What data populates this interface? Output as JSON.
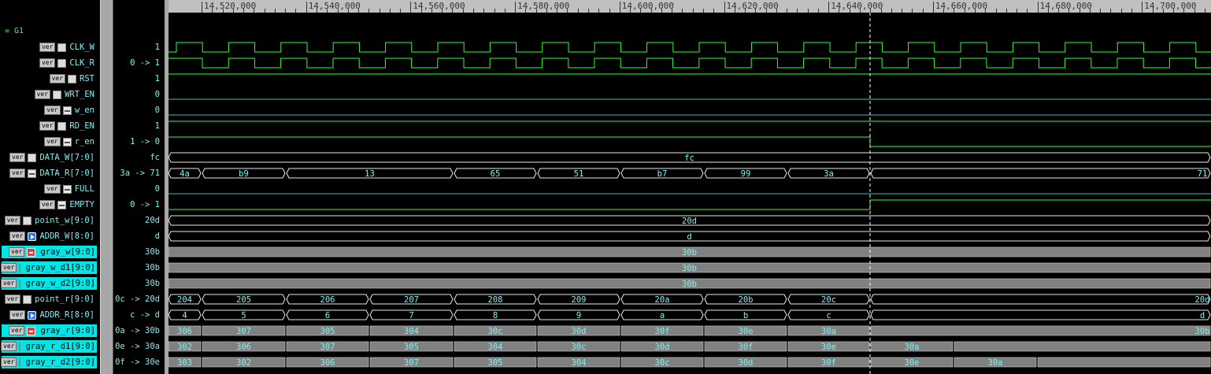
{
  "group_label": "= G1",
  "timeline": {
    "ticks": [
      "14,520,000",
      "14,540,000",
      "14,560,000",
      "14,580,000",
      "14,600,000",
      "14,620,000",
      "14,640,000",
      "14,660,000",
      "14,680,000",
      "14,700,000"
    ],
    "cursor_time": 14640000
  },
  "signals": [
    {
      "name": "CLK_W",
      "value": "1",
      "kind": "clock",
      "icon": "reg-icon"
    },
    {
      "name": "CLK_R",
      "value": "0 -> 1",
      "kind": "clock",
      "icon": "reg-icon"
    },
    {
      "name": "RST",
      "value": "1",
      "kind": "bit",
      "icon": "reg-icon"
    },
    {
      "name": "WRT_EN",
      "value": "0",
      "kind": "bit",
      "icon": "reg-icon"
    },
    {
      "name": "w_en",
      "value": "0",
      "kind": "bit",
      "icon": "wire-icon"
    },
    {
      "name": "RD_EN",
      "value": "1",
      "kind": "bit",
      "icon": "reg-icon"
    },
    {
      "name": "r_en",
      "value": "1 -> 0",
      "kind": "bit",
      "icon": "wire-icon"
    },
    {
      "name": "DATA_W[7:0]",
      "value": "fc",
      "kind": "bus",
      "icon": "reg-icon",
      "segments": [
        "fc"
      ]
    },
    {
      "name": "DATA_R[7:0]",
      "value": "3a -> 71",
      "kind": "bus",
      "icon": "wire-icon",
      "segments": [
        "4a",
        "b9",
        "13",
        "65",
        "51",
        "b7",
        "99",
        "3a",
        "71"
      ]
    },
    {
      "name": "FULL",
      "value": "0",
      "kind": "bit",
      "icon": "wire-icon"
    },
    {
      "name": "EMPTY",
      "value": "0 -> 1",
      "kind": "bit",
      "icon": "wire-icon"
    },
    {
      "name": "point_w[9:0]",
      "value": "20d",
      "kind": "bus",
      "icon": "reg-icon",
      "segments": [
        "20d"
      ]
    },
    {
      "name": "ADDR_W[8:0]",
      "value": "d",
      "kind": "bus",
      "icon": "arrow-icon",
      "segments": [
        "d"
      ]
    },
    {
      "name": "gray_w[9:0]",
      "value": "30b",
      "kind": "grayed",
      "icon": "gray-icon",
      "highlight": true,
      "segments": [
        "30b"
      ]
    },
    {
      "name": "gray_w_d1[9:0]",
      "value": "30b",
      "kind": "grayed",
      "icon": "reg-icon",
      "highlight": true,
      "segments": [
        "30b"
      ]
    },
    {
      "name": "gray_w_d2[9:0]",
      "value": "30b",
      "kind": "grayed",
      "icon": "reg-icon",
      "highlight": true,
      "segments": [
        "30b"
      ]
    },
    {
      "name": "point_r[9:0]",
      "value": "0c -> 20d",
      "kind": "bus",
      "icon": "reg-icon",
      "segments": [
        "204",
        "205",
        "206",
        "207",
        "208",
        "209",
        "20a",
        "20b",
        "20c",
        "20d"
      ]
    },
    {
      "name": "ADDR_R[8:0]",
      "value": "c -> d",
      "kind": "bus",
      "icon": "arrow-icon",
      "segments": [
        "4",
        "5",
        "6",
        "7",
        "8",
        "9",
        "a",
        "b",
        "c",
        "d"
      ]
    },
    {
      "name": "gray_r[9:0]",
      "value": "0a -> 30b",
      "kind": "grayed",
      "icon": "gray-icon",
      "highlight": true,
      "segments": [
        "306",
        "307",
        "305",
        "304",
        "30c",
        "30d",
        "30f",
        "30e",
        "30a",
        "30b"
      ]
    },
    {
      "name": "gray_r_d1[9:0]",
      "value": "0e -> 30a",
      "kind": "grayed",
      "icon": "reg-icon",
      "highlight": true,
      "segments": [
        "302",
        "306",
        "307",
        "305",
        "304",
        "30c",
        "30d",
        "30f",
        "30e",
        "30a",
        ""
      ]
    },
    {
      "name": "gray_r_d2[9:0]",
      "value": "0f -> 30e",
      "kind": "grayed",
      "icon": "reg-icon",
      "highlight": true,
      "segments": [
        "303",
        "302",
        "306",
        "307",
        "305",
        "304",
        "30c",
        "30d",
        "30f",
        "30e",
        "30a",
        ""
      ]
    }
  ],
  "ver_label": "ver",
  "colors": {
    "wave": "#30ff30",
    "bus": "#e8e8e8",
    "text": "#7ff0f0",
    "highlight": "#00e5e5",
    "grayed": "#808080",
    "cursor": "#ffffff"
  }
}
